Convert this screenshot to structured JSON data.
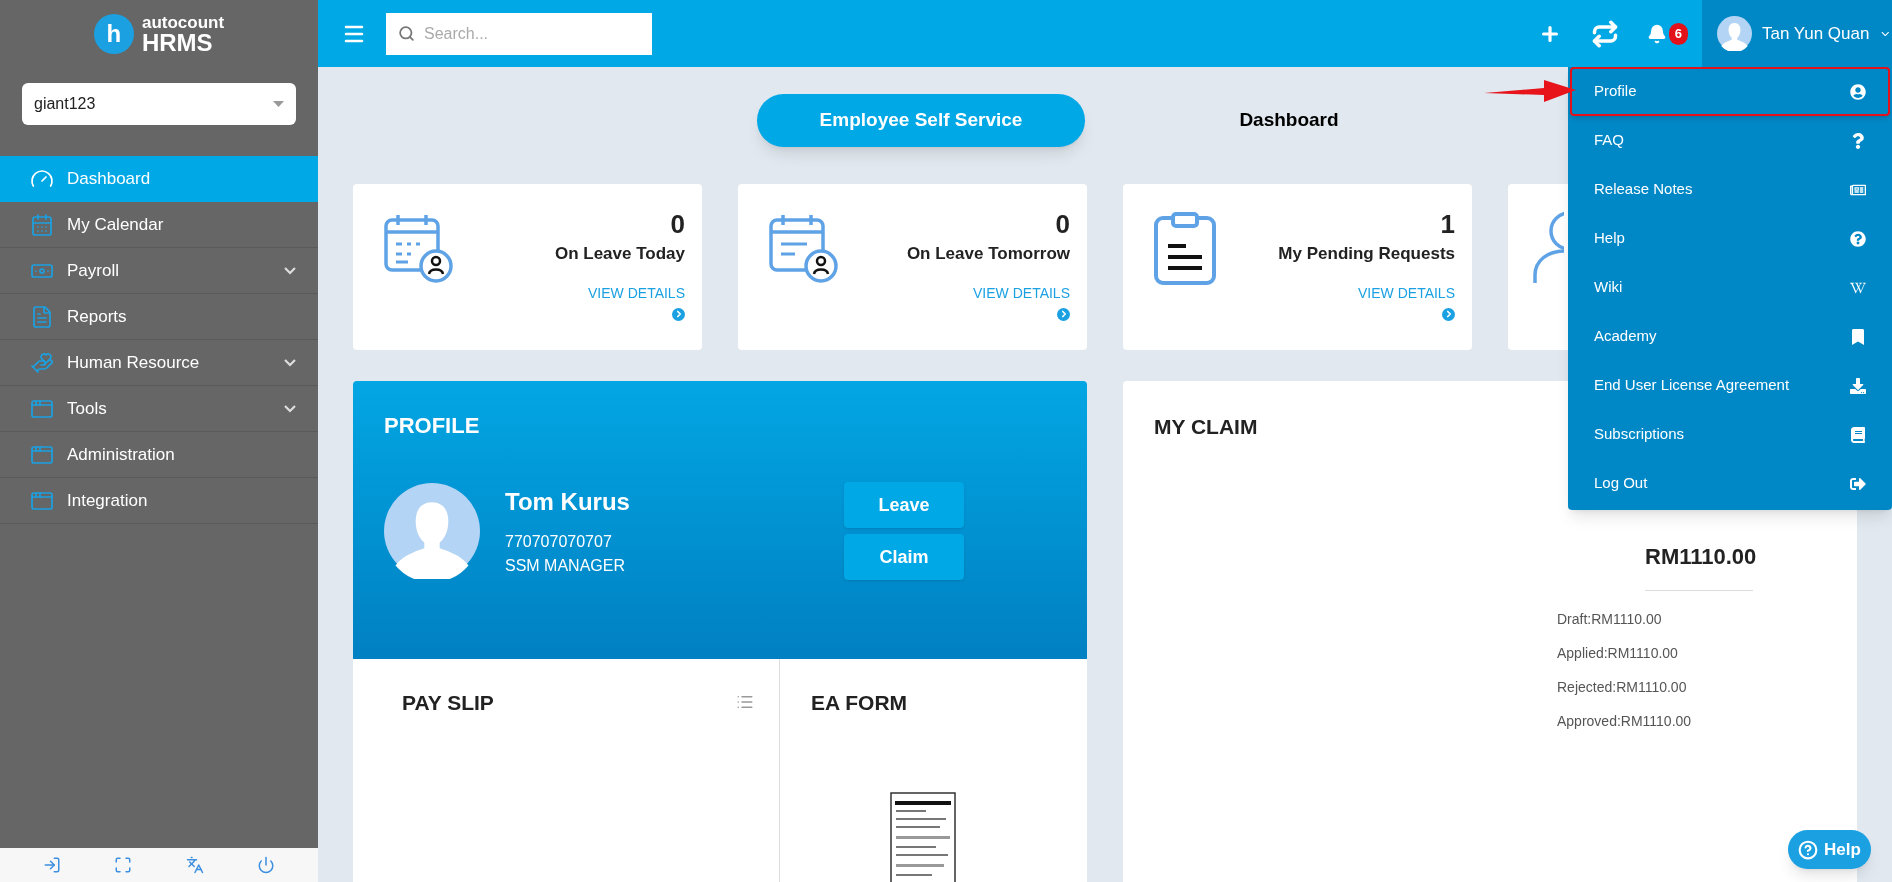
{
  "brand": {
    "word_top": "autocount",
    "word_main": "HRMS",
    "mark": "h"
  },
  "company_select": {
    "value": "giant123"
  },
  "sidebar": {
    "items": [
      {
        "label": "Dashboard",
        "selected": true,
        "expandable": false
      },
      {
        "label": "My Calendar",
        "selected": false,
        "expandable": false
      },
      {
        "label": "Payroll",
        "selected": false,
        "expandable": true
      },
      {
        "label": "Reports",
        "selected": false,
        "expandable": false
      },
      {
        "label": "Human Resource",
        "selected": false,
        "expandable": true
      },
      {
        "label": "Tools",
        "selected": false,
        "expandable": true
      },
      {
        "label": "Administration",
        "selected": false,
        "expandable": false
      },
      {
        "label": "Integration",
        "selected": false,
        "expandable": false
      }
    ]
  },
  "topbar": {
    "search": {
      "placeholder": "Search..."
    },
    "notification_count": "6",
    "user_name": "Tan Yun Quan"
  },
  "user_menu": {
    "items": [
      {
        "label": "Profile",
        "highlighted": true
      },
      {
        "label": "FAQ",
        "highlighted": false
      },
      {
        "label": "Release Notes",
        "highlighted": false
      },
      {
        "label": "Help",
        "highlighted": false
      },
      {
        "label": "Wiki",
        "highlighted": false
      },
      {
        "label": "Academy",
        "highlighted": false
      },
      {
        "label": "End User License Agreement",
        "highlighted": false
      },
      {
        "label": "Subscriptions",
        "highlighted": false
      },
      {
        "label": "Log Out",
        "highlighted": false
      }
    ]
  },
  "view_tabs": [
    {
      "label": "Employee Self Service",
      "selected": true
    },
    {
      "label": "Dashboard",
      "selected": false
    }
  ],
  "stat_cards": [
    {
      "count": "0",
      "label": "On Leave Today",
      "link": "VIEW DETAILS"
    },
    {
      "count": "0",
      "label": "On Leave Tomorrow",
      "link": "VIEW DETAILS"
    },
    {
      "count": "1",
      "label": "My Pending Requests",
      "link": "VIEW DETAILS"
    }
  ],
  "profile": {
    "title": "PROFILE",
    "name": "Tom Kurus",
    "id": "770707070707",
    "position": "SSM MANAGER",
    "buttons": [
      "Leave",
      "Claim"
    ]
  },
  "pay_slip": {
    "title": "PAY SLIP"
  },
  "ea_form": {
    "title": "EA FORM"
  },
  "my_claim": {
    "title": "MY CLAIM",
    "total": "RM1110.00",
    "breakdown": [
      "Draft:RM1110.00",
      "Applied:RM1110.00",
      "Rejected:RM1110.00",
      "Approved:RM1110.00"
    ]
  },
  "help_button": {
    "label": "Help"
  }
}
